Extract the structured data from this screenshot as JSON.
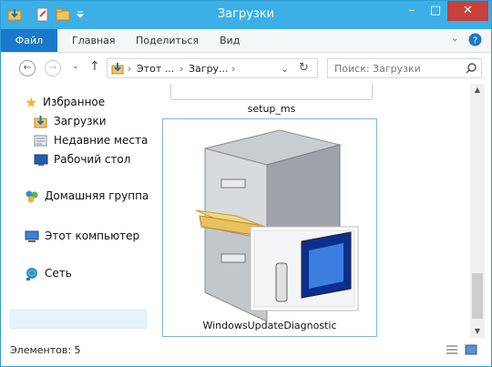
{
  "window": {
    "title": "Загрузки"
  },
  "ribbon": {
    "tabs": [
      "Файл",
      "Главная",
      "Поделиться",
      "Вид"
    ]
  },
  "address": {
    "crumbs": [
      "Этот ...",
      "Загру..."
    ]
  },
  "search": {
    "placeholder": "Поиск: Загрузки"
  },
  "sidebar": {
    "favorites": "Избранное",
    "items": [
      "Загрузки",
      "Недавние места",
      "Рабочий стол"
    ],
    "homegroup": "Домашняя группа",
    "this_pc": "Этот компьютер",
    "network": "Сеть"
  },
  "files": [
    {
      "name": "setup_ms"
    },
    {
      "name": "WindowsUpdateDiagnostic"
    }
  ],
  "status": {
    "count": "Элементов: 5"
  },
  "colors": {
    "titlebar": "#3cb0e6",
    "file_tab": "#1979ca",
    "close": "#c7413c"
  }
}
